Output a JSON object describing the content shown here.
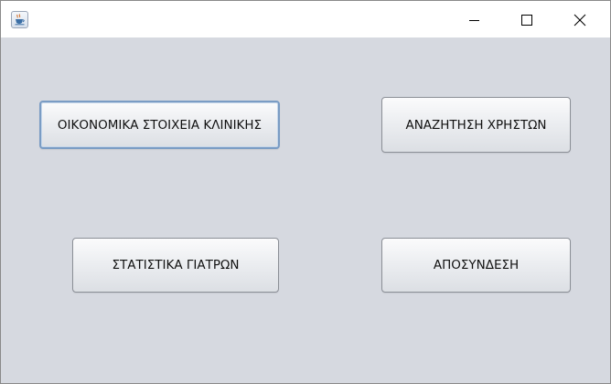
{
  "window": {
    "app_icon": "java-coffee-cup-icon",
    "controls": {
      "minimize_icon": "minimize-icon",
      "maximize_icon": "maximize-icon",
      "close_icon": "close-icon"
    }
  },
  "main": {
    "buttons": {
      "financial_label": "ΟΙΚΟΝΟΜΙΚΑ ΣΤΟΙΧΕΙΑ ΚΛΙΝΙΚΗΣ",
      "search_users_label": "ΑΝΑΖΗΤΗΣΗ ΧΡΗΣΤΩΝ",
      "doctor_stats_label": "ΣΤΑΤΙΣΤΙΚΑ ΓΙΑΤΡΩΝ",
      "logout_label": "ΑΠΟΣΥΝΔΕΣΗ"
    },
    "focused_button": "financial_label"
  },
  "colors": {
    "content_background": "#d6d9e0",
    "titlebar_background": "#ffffff",
    "focus_border": "#7a9cc4"
  }
}
